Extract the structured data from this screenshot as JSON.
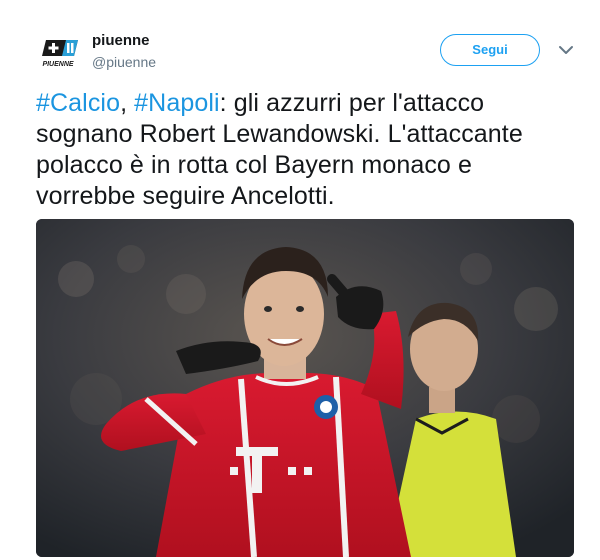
{
  "author": {
    "logo_text": "PIUENNE",
    "display_name": "piuenne",
    "handle": "@piuenne"
  },
  "follow_button": {
    "label": "Segui"
  },
  "tweet": {
    "hashtag_1": "#Calcio",
    "sep_1": ", ",
    "hashtag_2": "#Napoli",
    "body": ": gli azzurri per l'attacco sognano Robert Lewandowski. L'attaccante polacco è in rotta col Bayern monaco e vorrebbe seguire Ancelotti."
  },
  "colors": {
    "accent": "#1da1f2",
    "hashtag": "#1b95e0",
    "text": "#14171a",
    "muted": "#657786",
    "bayern_red": "#d2162c",
    "referee_yellow": "#d4e03a"
  },
  "icons": {
    "caret": "chevron-down-icon",
    "logo": "piuenne-logo"
  }
}
